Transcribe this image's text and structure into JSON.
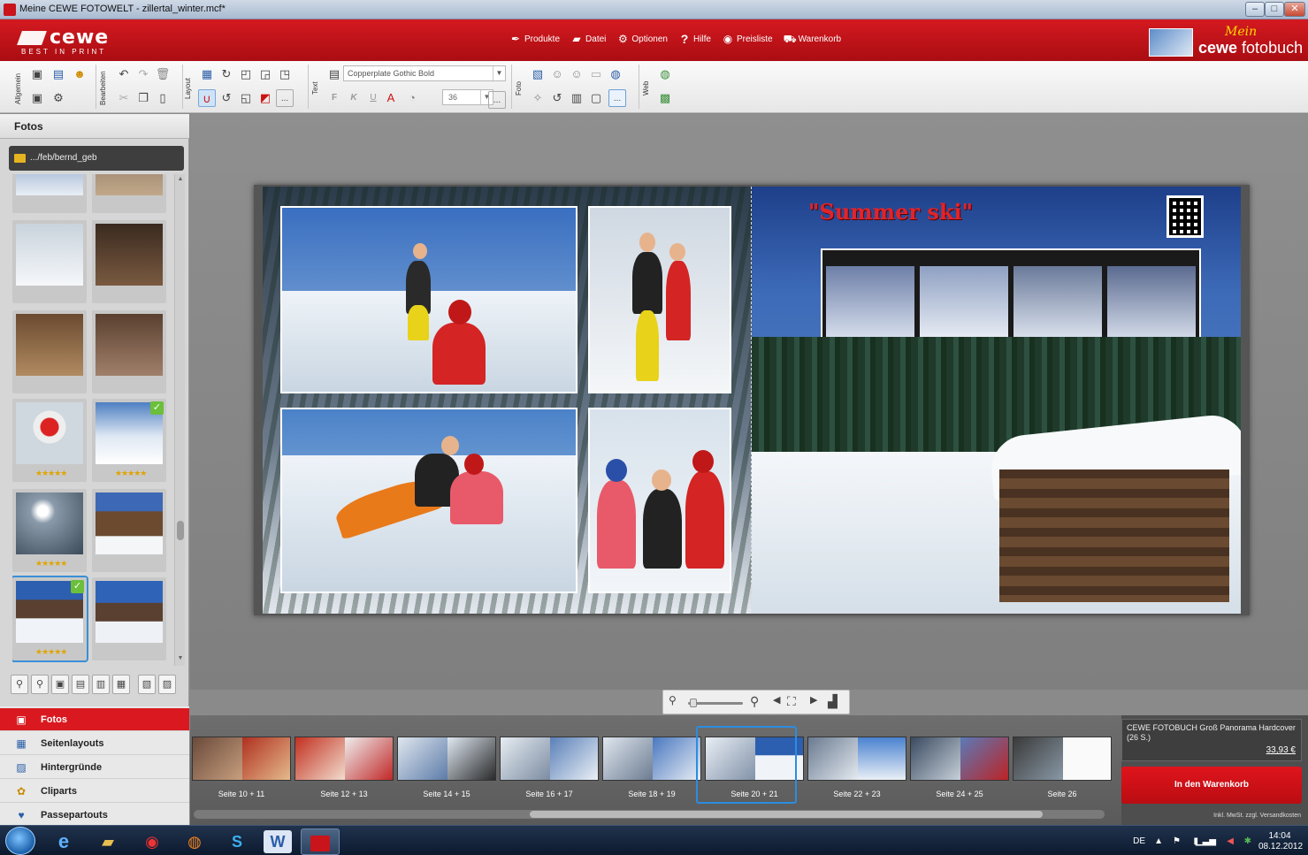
{
  "window": {
    "title": "Meine CEWE FOTOWELT - zillertal_winter.mcf*"
  },
  "brand": {
    "name": "cewe",
    "tagline": "BEST IN PRINT",
    "right_logo_top": "Mein",
    "right_logo_a": "cewe",
    "right_logo_b": " fotobuch"
  },
  "menu": [
    {
      "label": "Produkte",
      "icon": "pen-icon"
    },
    {
      "label": "Datei",
      "icon": "folder-icon"
    },
    {
      "label": "Optionen",
      "icon": "gear-icon"
    },
    {
      "label": "Hilfe",
      "icon": "help-icon"
    },
    {
      "label": "Preisliste",
      "icon": "price-icon"
    },
    {
      "label": "Warenkorb",
      "icon": "cart-icon"
    }
  ],
  "toolbar": {
    "groups": [
      "Allgemein",
      "Bearbeiten",
      "Layout",
      "Text",
      "Foto",
      "Web"
    ],
    "font": "Copperplate Gothic Bold",
    "font_size": "36",
    "bold": "F",
    "italic": "K",
    "underline": "U",
    "more": "..."
  },
  "panel": {
    "header": "Fotos",
    "path": ".../feb/bernd_geb"
  },
  "categories": [
    {
      "label": "Fotos",
      "icon": "photos-icon"
    },
    {
      "label": "Seitenlayouts",
      "icon": "layouts-icon"
    },
    {
      "label": "Hintergründe",
      "icon": "backgrounds-icon"
    },
    {
      "label": "Cliparts",
      "icon": "cliparts-icon"
    },
    {
      "label": "Passepartouts",
      "icon": "passepartouts-icon"
    }
  ],
  "page": {
    "title": "\"Summer ski\""
  },
  "spreads": [
    "Seite 10 + 11",
    "Seite 12 + 13",
    "Seite 14 + 15",
    "Seite 16 + 17",
    "Seite 18 + 19",
    "Seite 20 + 21",
    "Seite 22 + 23",
    "Seite 24 + 25",
    "Seite 26"
  ],
  "selected_spread": "Seite 20 + 21",
  "cart": {
    "product": "CEWE FOTOBUCH Groß Panorama Hardcover  (26 S.)",
    "price": "33,93 €",
    "button": "In den Warenkorb",
    "note": "Inkl. MwSt. zzgl. Versandkosten"
  },
  "taskbar": {
    "lang": "DE",
    "time": "14:04",
    "date": "08.12.2012"
  },
  "colors": {
    "brand_red": "#d9191f",
    "selection_blue": "#2b8de0"
  }
}
